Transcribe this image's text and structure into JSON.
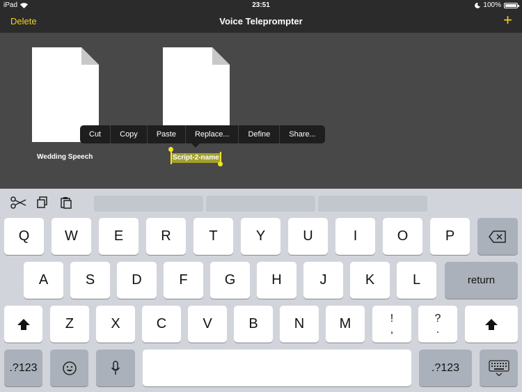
{
  "status_bar": {
    "device": "iPad",
    "time": "23:51",
    "battery_percent": "100%",
    "battery_level": 1.0
  },
  "navbar": {
    "delete_label": "Delete",
    "title": "Voice Teleprompter",
    "add_label": "+"
  },
  "documents": [
    {
      "label": "Wedding Speech"
    },
    {
      "label": "Script-2-name",
      "editing": true
    }
  ],
  "context_menu": {
    "items": [
      "Cut",
      "Copy",
      "Paste",
      "Replace...",
      "Define",
      "Share..."
    ]
  },
  "keyboard": {
    "row1": [
      "Q",
      "W",
      "E",
      "R",
      "T",
      "Y",
      "U",
      "I",
      "O",
      "P"
    ],
    "row2": [
      "A",
      "S",
      "D",
      "F",
      "G",
      "H",
      "J",
      "K",
      "L"
    ],
    "row3": [
      "Z",
      "X",
      "C",
      "V",
      "B",
      "N",
      "M"
    ],
    "row3_punct": [
      {
        "top": "!",
        "bottom": ","
      },
      {
        "top": "?",
        "bottom": "."
      }
    ],
    "return_label": "return",
    "numbers_label": ".?123"
  },
  "colors": {
    "accent": "#f5d31f",
    "nav_bg": "#2b2b2b",
    "content_bg": "#484848",
    "keyboard_bg": "#d1d4da",
    "selection": "#a2a12f"
  }
}
